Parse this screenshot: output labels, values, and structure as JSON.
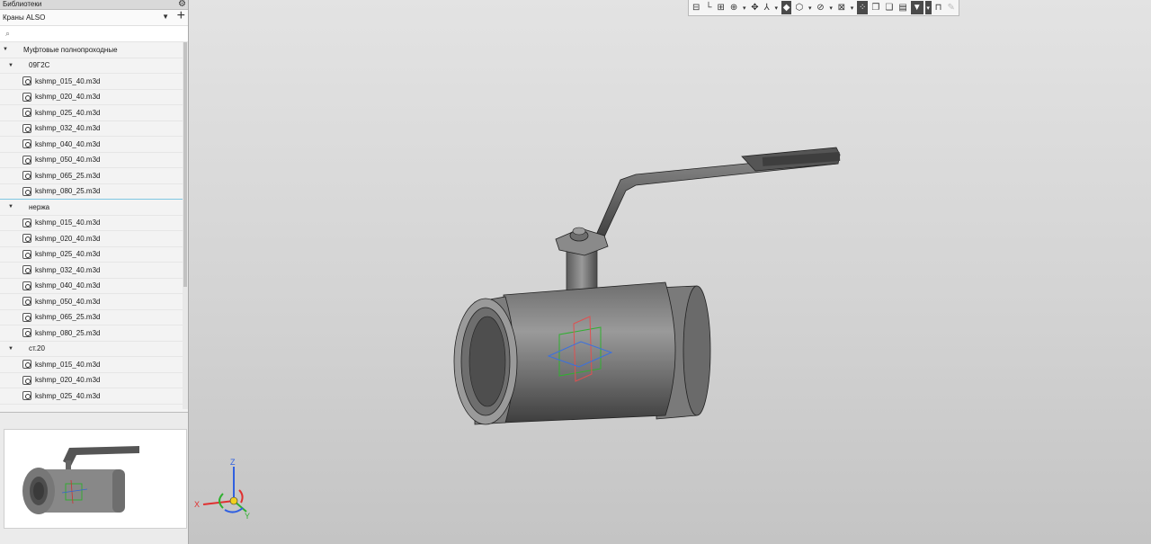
{
  "panel": {
    "title": "Библиотеки",
    "library_name": "Краны ALSO",
    "tree": [
      {
        "kind": "group",
        "label": "Муфтовые полнопроходные"
      },
      {
        "kind": "sub",
        "label": "09Г2С"
      },
      {
        "kind": "file",
        "label": "kshmp_015_40.m3d"
      },
      {
        "kind": "file",
        "label": "kshmp_020_40.m3d"
      },
      {
        "kind": "file",
        "label": "kshmp_025_40.m3d"
      },
      {
        "kind": "file",
        "label": "kshmp_032_40.m3d"
      },
      {
        "kind": "file",
        "label": "kshmp_040_40.m3d"
      },
      {
        "kind": "file",
        "label": "kshmp_050_40.m3d"
      },
      {
        "kind": "file",
        "label": "kshmp_065_25.m3d"
      },
      {
        "kind": "file",
        "label": "kshmp_080_25.m3d",
        "selected": true
      },
      {
        "kind": "sub",
        "label": "нержа"
      },
      {
        "kind": "file",
        "label": "kshmp_015_40.m3d"
      },
      {
        "kind": "file",
        "label": "kshmp_020_40.m3d"
      },
      {
        "kind": "file",
        "label": "kshmp_025_40.m3d"
      },
      {
        "kind": "file",
        "label": "kshmp_032_40.m3d"
      },
      {
        "kind": "file",
        "label": "kshmp_040_40.m3d"
      },
      {
        "kind": "file",
        "label": "kshmp_050_40.m3d"
      },
      {
        "kind": "file",
        "label": "kshmp_065_25.m3d"
      },
      {
        "kind": "file",
        "label": "kshmp_080_25.m3d"
      },
      {
        "kind": "sub",
        "label": "ст.20"
      },
      {
        "kind": "file",
        "label": "kshmp_015_40.m3d"
      },
      {
        "kind": "file",
        "label": "kshmp_020_40.m3d"
      },
      {
        "kind": "file",
        "label": "kshmp_025_40.m3d"
      }
    ]
  },
  "toolbar": [
    {
      "icon": "sketch-icon",
      "glyph": "⊟"
    },
    {
      "icon": "coordinate-system-icon",
      "glyph": "└"
    },
    {
      "icon": "view-orient-icon",
      "glyph": "⊞"
    },
    {
      "icon": "zoom-icon",
      "glyph": "⊕"
    },
    {
      "icon": "dropdown-caret-icon",
      "glyph": "▾",
      "caret": true
    },
    {
      "icon": "pan-icon",
      "glyph": "✥"
    },
    {
      "icon": "orientation-icon",
      "glyph": "⅄"
    },
    {
      "icon": "dropdown-caret-icon",
      "glyph": "▾",
      "caret": true
    },
    {
      "icon": "shaded-display-icon",
      "glyph": "◆",
      "active": true
    },
    {
      "icon": "wireframe-display-icon",
      "glyph": "⬡"
    },
    {
      "icon": "dropdown-caret-icon",
      "glyph": "▾",
      "caret": true
    },
    {
      "icon": "hidden-lines-icon",
      "glyph": "⊘"
    },
    {
      "icon": "dropdown-caret-icon",
      "glyph": "▾",
      "caret": true
    },
    {
      "icon": "section-view-icon",
      "glyph": "⊠"
    },
    {
      "icon": "dropdown-caret-icon",
      "glyph": "▾",
      "caret": true
    },
    {
      "icon": "show-all-icon",
      "glyph": "⁘",
      "active": true
    },
    {
      "icon": "copy-icon",
      "glyph": "❐"
    },
    {
      "icon": "paste-icon",
      "glyph": "❏"
    },
    {
      "icon": "properties-icon",
      "glyph": "▤"
    },
    {
      "icon": "filter-icon",
      "glyph": "▼",
      "active": true
    },
    {
      "icon": "dropdown-caret-icon",
      "glyph": "▾",
      "caret": true,
      "active": true
    },
    {
      "icon": "measure-icon",
      "glyph": "⊓"
    },
    {
      "icon": "eyedropper-icon",
      "glyph": "✎",
      "dim": true
    }
  ],
  "axes": {
    "x": "X",
    "y": "Y",
    "z": "Z"
  },
  "colors": {
    "steel_dark": "#5a5a5a",
    "steel_light": "#b8b8b8",
    "axis_x": "#e03030",
    "axis_y": "#30b030",
    "axis_z": "#3060e0"
  }
}
